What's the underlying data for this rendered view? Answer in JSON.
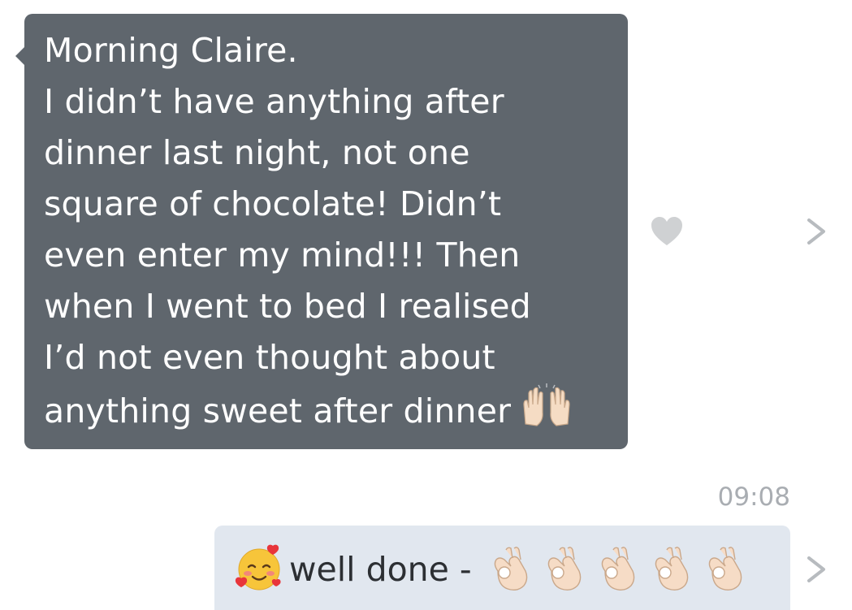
{
  "messages": {
    "incoming": {
      "lines": [
        "Morning Claire.",
        "I didn’t have anything after",
        "dinner last night, not one",
        "square of chocolate! Didn’t",
        "even enter my mind!!! Then",
        "when I went to bed I realised",
        "I’d not even thought about",
        "anything sweet after dinner"
      ],
      "trailing_emoji": "raising-hands-emoji"
    },
    "timestamp": "09:08",
    "outgoing": {
      "leading_emoji": "smiling-face-with-hearts-emoji",
      "text": "well done -",
      "trailing_emoji": "ok-hand-emoji",
      "trailing_emoji_count": 5
    }
  },
  "icons": {
    "like": "heart-icon",
    "detail": "chevron-right-icon"
  },
  "colors": {
    "incoming_bubble": "#5f666d",
    "outgoing_bubble": "#e1e7ef",
    "heart": "#cfd1d3",
    "chevron": "#b7bbbf",
    "timestamp": "#a9adb2"
  }
}
